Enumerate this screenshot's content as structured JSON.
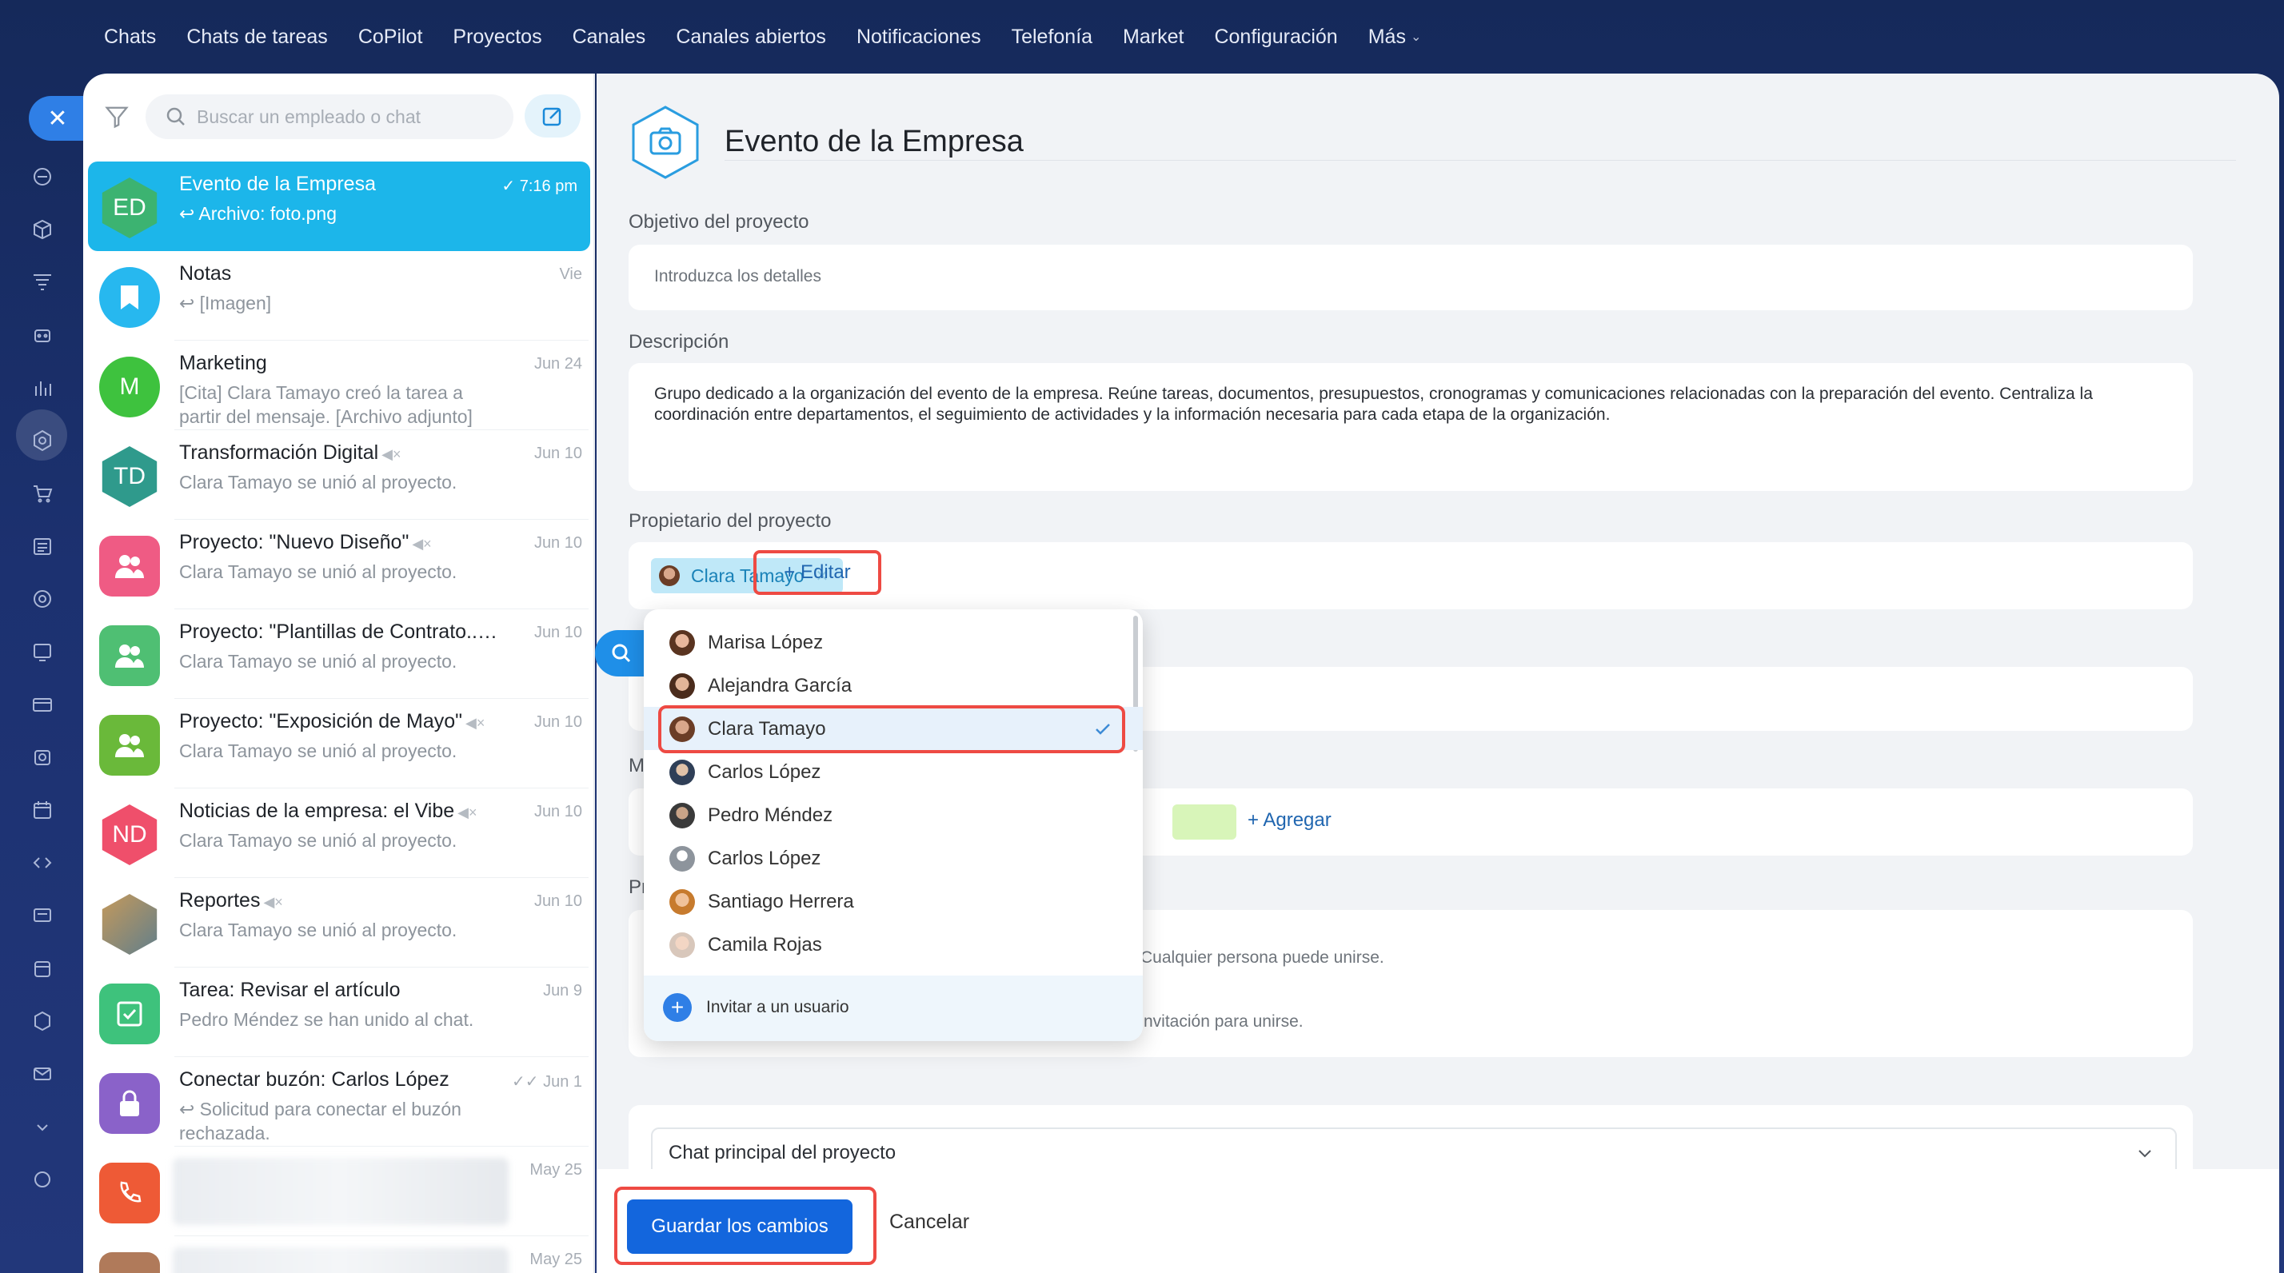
{
  "topnav": {
    "items": [
      "Chats",
      "Chats de tareas",
      "CoPilot",
      "Proyectos",
      "Canales",
      "Canales abiertos",
      "Notificaciones",
      "Telefonía",
      "Market",
      "Configuración",
      "Más"
    ]
  },
  "search": {
    "placeholder": "Buscar un empleado o chat"
  },
  "chats": [
    {
      "title": "Evento de la Empresa",
      "sub": "↩ Archivo: foto.png",
      "date": "✓ 7:16 pm",
      "avatar": "ED"
    },
    {
      "title": "Notas",
      "sub": "↩ [Imagen]",
      "date": "Vie"
    },
    {
      "title": "Marketing",
      "sub": "[Cita] Clara Tamayo creó la tarea a partir del mensaje. [Archivo adjunto]",
      "date": "Jun 24",
      "avatar": "M"
    },
    {
      "title": "Transformación Digital",
      "sub": "Clara Tamayo se unió al proyecto.",
      "date": "Jun 10",
      "avatar": "TD"
    },
    {
      "title": "Proyecto: \"Nuevo Diseño\"",
      "sub": "Clara Tamayo se unió al proyecto.",
      "date": "Jun 10"
    },
    {
      "title": "Proyecto: \"Plantillas de Contrato...",
      "sub": "Clara Tamayo se unió al proyecto.",
      "date": "Jun 10"
    },
    {
      "title": "Proyecto: \"Exposición de Mayo\"",
      "sub": "Clara Tamayo se unió al proyecto.",
      "date": "Jun 10"
    },
    {
      "title": "Noticias de la empresa: el Vibe",
      "sub": "Clara Tamayo se unió al proyecto.",
      "date": "Jun 10",
      "avatar": "ND"
    },
    {
      "title": "Reportes",
      "sub": "Clara Tamayo se unió al proyecto.",
      "date": "Jun 10"
    },
    {
      "title": "Tarea: Revisar el artículo",
      "sub": "Pedro Méndez se han unido al chat.",
      "date": "Jun 9"
    },
    {
      "title": "Conectar buzón: Carlos López",
      "sub": "↩ Solicitud para conectar el buzón rechazada.",
      "date": "✓✓ Jun 1"
    },
    {
      "date": "May 25"
    },
    {
      "date": "May 25"
    }
  ],
  "main": {
    "title": "Evento de la Empresa",
    "goal_label": "Objetivo del proyecto",
    "goal_placeholder": "Introduzca los detalles",
    "desc_label": "Descripción",
    "desc_text": "Grupo dedicado a la organización del evento de la empresa. Reúne tareas, documentos, presupuestos, cronogramas y comunicaciones relacionadas con la preparación del evento. Centraliza la coordinación entre departamentos, el seguimiento de actividades y la información necesaria para cada etapa de la organización.",
    "owner_label": "Propietario del proyecto",
    "owner_name": "Clara Tamayo",
    "edit_label": "+ Editar",
    "members_partial_label": "M",
    "add_label": "+ Agregar",
    "privacy_partial_label": "Pr",
    "open_text": "Cualquier persona puede unirse.",
    "invite_text": "nvitación para unirse.",
    "main_chat_label": "Chat principal del proyecto",
    "save_label": "Guardar los cambios",
    "cancel_label": "Cancelar"
  },
  "dropdown": {
    "users": [
      "Marisa López",
      "Alejandra García",
      "Clara Tamayo",
      "Carlos López",
      "Pedro Méndez",
      "Carlos López",
      "Santiago Herrera",
      "Camila Rojas"
    ],
    "selected": "Clara Tamayo",
    "invite_label": "Invitar a un usuario"
  },
  "colors": {
    "accent": "#1cb6ea",
    "primary_button": "#1366dd",
    "highlight_border": "#ee4a43"
  }
}
